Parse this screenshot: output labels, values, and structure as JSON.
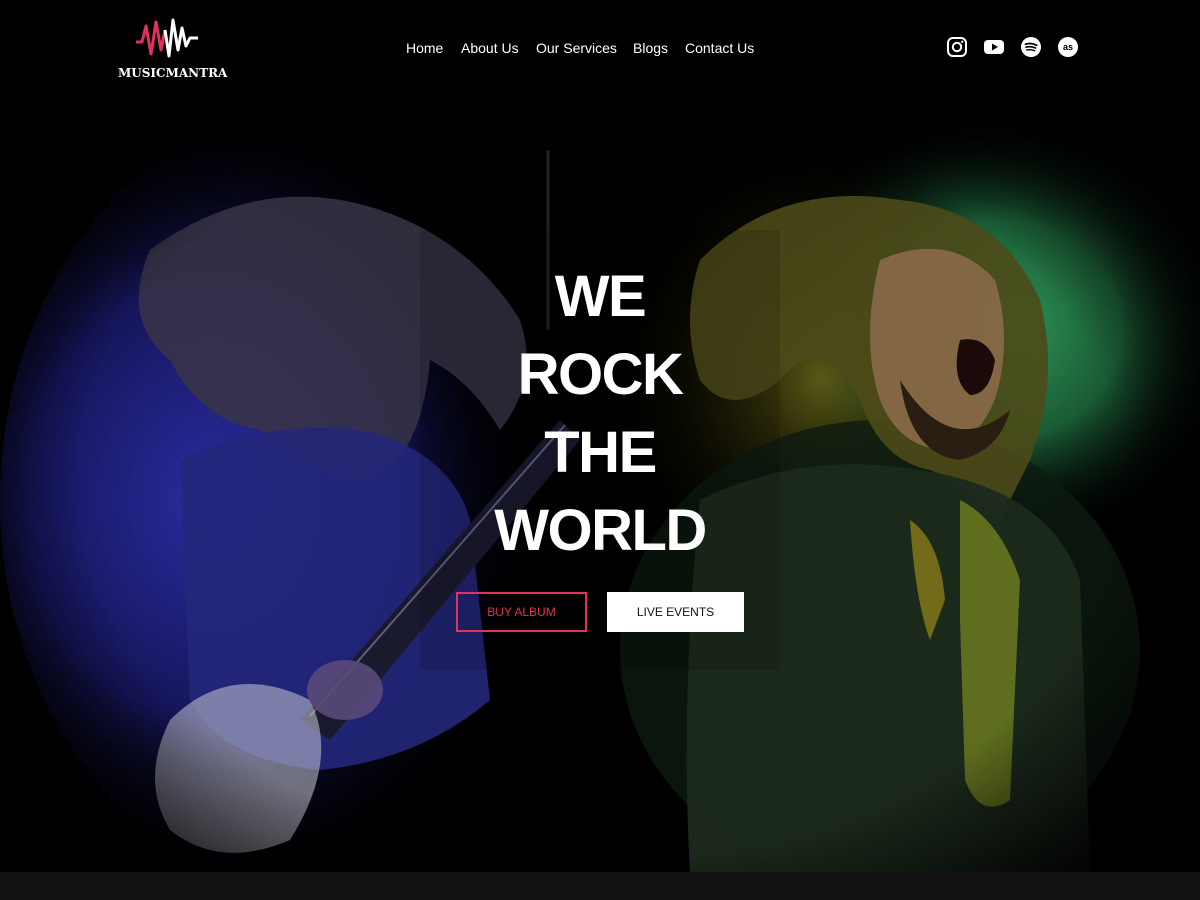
{
  "brand": {
    "name": "MUSICMANTRA",
    "logo_icon": "soundwave-logo-icon",
    "accent_color": "#e0325c"
  },
  "nav": {
    "items": [
      {
        "label": "Home"
      },
      {
        "label": "About Us"
      },
      {
        "label": "Our Services"
      },
      {
        "label": "Blogs"
      },
      {
        "label": "Contact Us"
      }
    ]
  },
  "social": {
    "items": [
      {
        "icon": "instagram-icon"
      },
      {
        "icon": "youtube-icon"
      },
      {
        "icon": "spotify-icon"
      },
      {
        "icon": "lastfm-icon"
      }
    ]
  },
  "hero": {
    "headline": [
      "WE",
      "ROCK",
      "THE",
      "WORLD"
    ],
    "buy_button": "BUY ALBUM",
    "events_button": "LIVE EVENTS"
  }
}
